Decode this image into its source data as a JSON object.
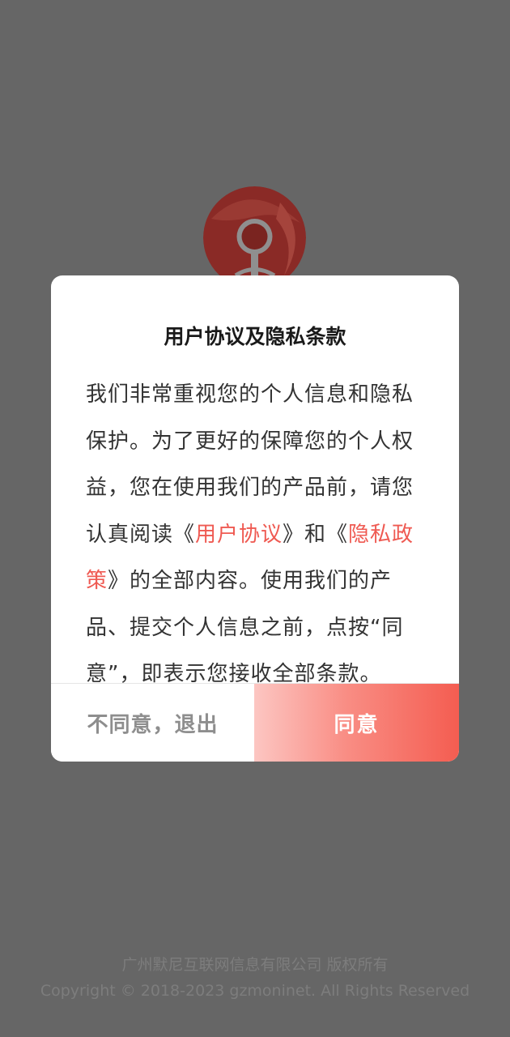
{
  "dialog": {
    "title": "用户协议及隐私条款",
    "body_parts": {
      "p1": "我们非常重视您的个人信息和隐私保护。为了更好的保障您的个人权益，您在使用我们的产品前，请您认真阅读《",
      "link1": "用户协议",
      "p2": "》和《",
      "link2": "隐私政策",
      "p3": "》的全部内容。使用我们的产品、提交个人信息之前，点按“同意”，即表示您接收全部条款。"
    },
    "decline_label": "不同意，退出",
    "agree_label": "同意"
  },
  "footer": {
    "company": "广州默尼互联网信息有限公司 版权所有",
    "copyright": "Copyright © 2018-2023 gzmoninet. All Rights Reserved"
  },
  "colors": {
    "overlay": "#666666",
    "link": "#ef5a52",
    "agree_start": "#fcc6c2",
    "agree_end": "#f45d51"
  },
  "icons": {
    "logo": "app-logo-icon"
  }
}
